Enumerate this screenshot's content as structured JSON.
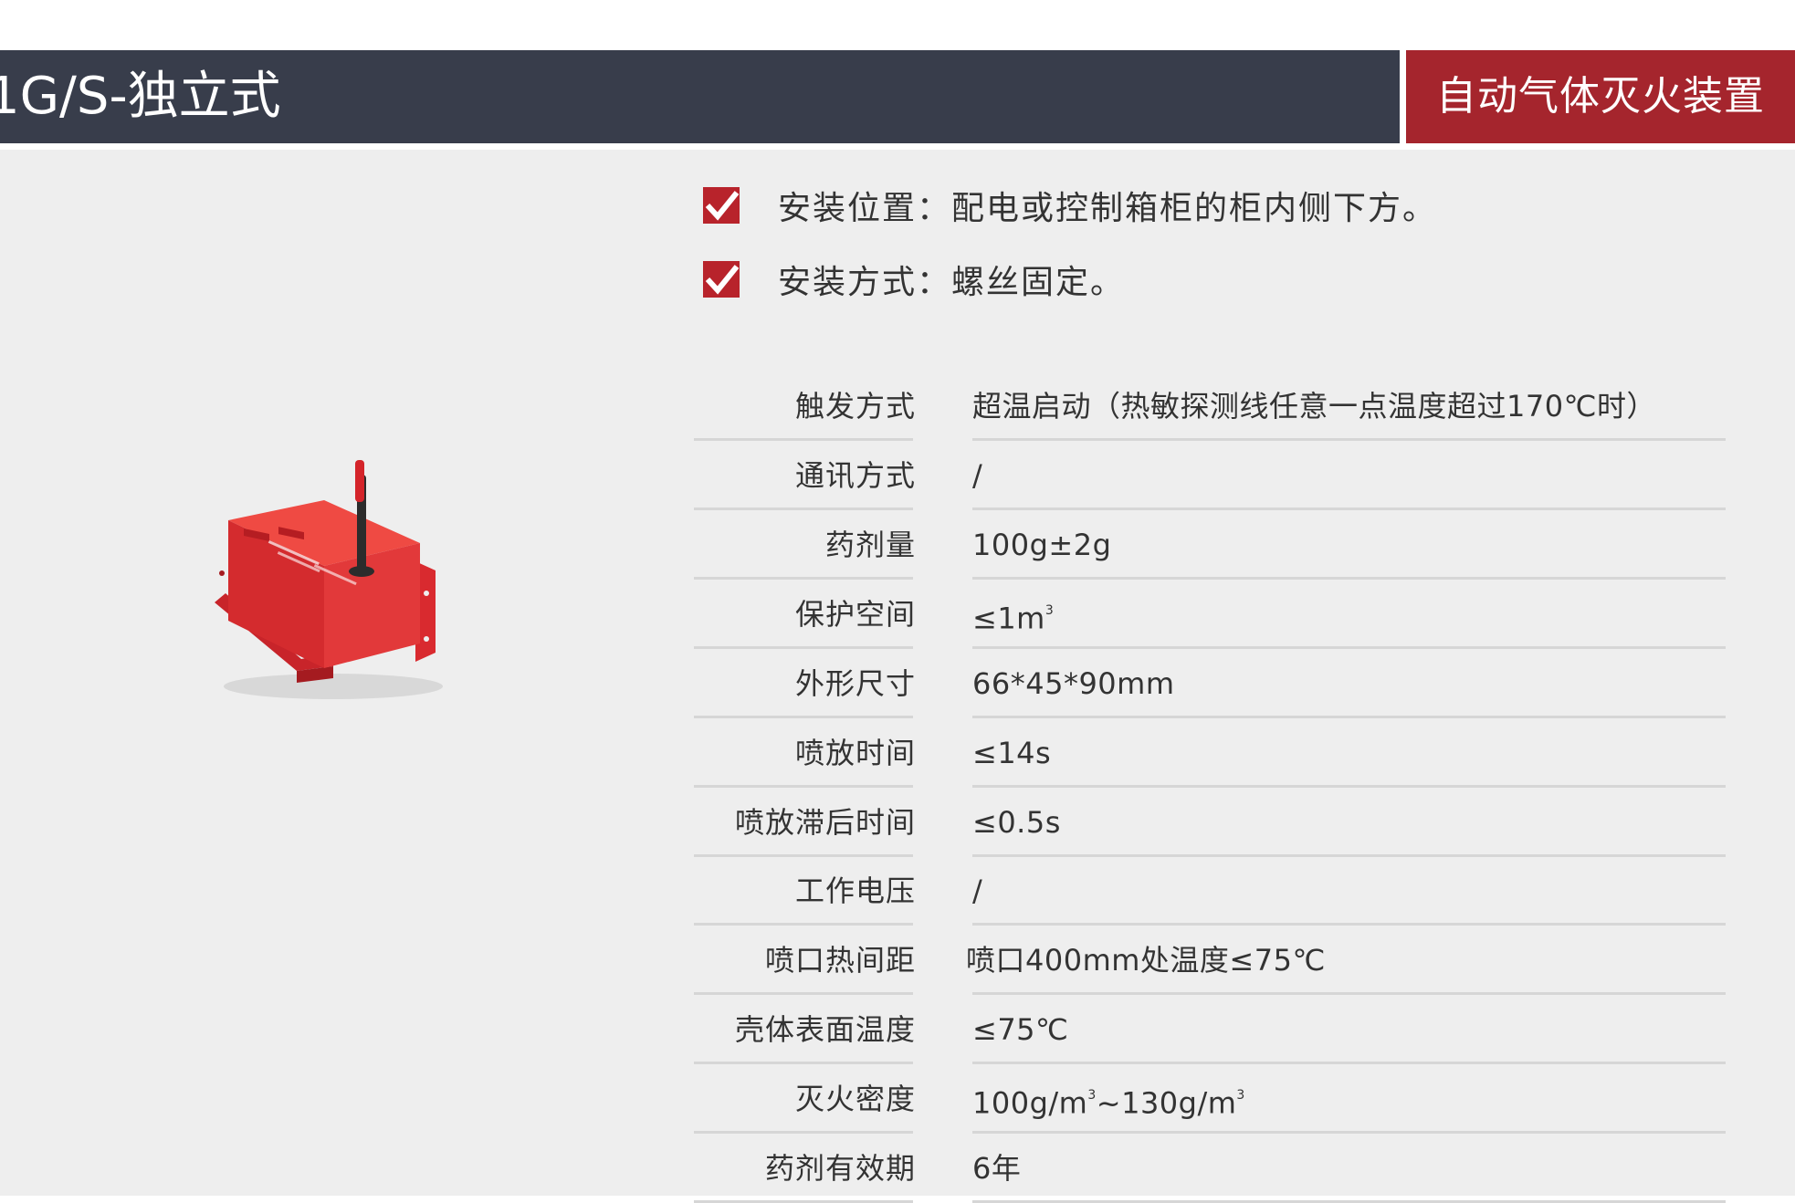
{
  "header": {
    "model_title": "1G/S-独立式",
    "category": "自动气体灭火装置"
  },
  "features": [
    {
      "text": "安装位置：配电或控制箱柜的柜内侧下方。"
    },
    {
      "text": "安装方式：螺丝固定。"
    }
  ],
  "specs": [
    {
      "label": "触发方式",
      "value": "超温启动（热敏探测线任意一点温度超过170℃时）"
    },
    {
      "label": "通讯方式",
      "value": "/"
    },
    {
      "label": "药剂量",
      "value": "100g±2g"
    },
    {
      "label": "保护空间",
      "value": "≤1m",
      "sup": "3"
    },
    {
      "label": "外形尺寸",
      "value": "66*45*90mm"
    },
    {
      "label": "喷放时间",
      "value": "≤14s"
    },
    {
      "label": "喷放滞后时间",
      "value": "≤0.5s"
    },
    {
      "label": "工作电压",
      "value": "/"
    },
    {
      "label": "喷口热间距",
      "value": "喷口400mm处温度≤75℃"
    },
    {
      "label": "壳体表面温度",
      "value": "≤75℃"
    },
    {
      "label": "灭火密度",
      "value_a": "100g/m",
      "sup_a": "3",
      "value_b": "~130g/m",
      "sup_b": "3"
    },
    {
      "label": "药剂有效期",
      "value": "6年"
    }
  ],
  "icons": {
    "feature_bullet": "checkbox-checked-icon"
  },
  "colors": {
    "header_dark": "#383d4b",
    "accent_red": "#a5252d",
    "background": "#eeeeee"
  }
}
